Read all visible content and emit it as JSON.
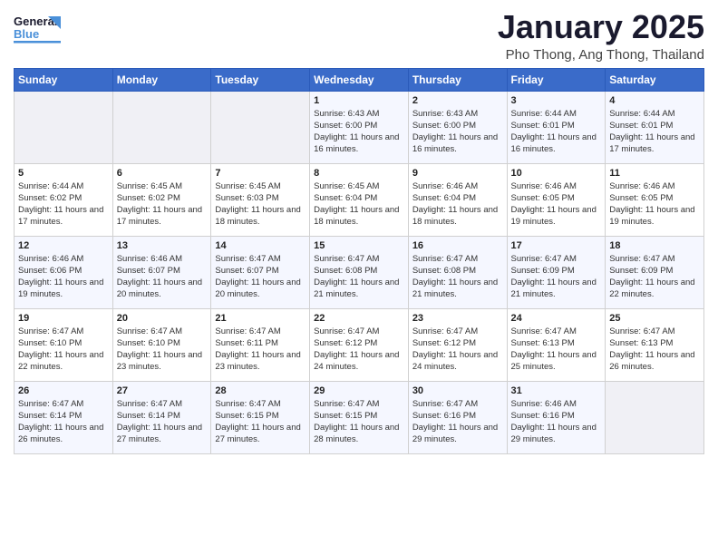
{
  "header": {
    "logo_line1": "General",
    "logo_line2": "Blue",
    "month_title": "January 2025",
    "subtitle": "Pho Thong, Ang Thong, Thailand"
  },
  "days_of_week": [
    "Sunday",
    "Monday",
    "Tuesday",
    "Wednesday",
    "Thursday",
    "Friday",
    "Saturday"
  ],
  "weeks": [
    [
      {
        "day": "",
        "info": ""
      },
      {
        "day": "",
        "info": ""
      },
      {
        "day": "",
        "info": ""
      },
      {
        "day": "1",
        "info": "Sunrise: 6:43 AM\nSunset: 6:00 PM\nDaylight: 11 hours and 16 minutes."
      },
      {
        "day": "2",
        "info": "Sunrise: 6:43 AM\nSunset: 6:00 PM\nDaylight: 11 hours and 16 minutes."
      },
      {
        "day": "3",
        "info": "Sunrise: 6:44 AM\nSunset: 6:01 PM\nDaylight: 11 hours and 16 minutes."
      },
      {
        "day": "4",
        "info": "Sunrise: 6:44 AM\nSunset: 6:01 PM\nDaylight: 11 hours and 17 minutes."
      }
    ],
    [
      {
        "day": "5",
        "info": "Sunrise: 6:44 AM\nSunset: 6:02 PM\nDaylight: 11 hours and 17 minutes."
      },
      {
        "day": "6",
        "info": "Sunrise: 6:45 AM\nSunset: 6:02 PM\nDaylight: 11 hours and 17 minutes."
      },
      {
        "day": "7",
        "info": "Sunrise: 6:45 AM\nSunset: 6:03 PM\nDaylight: 11 hours and 18 minutes."
      },
      {
        "day": "8",
        "info": "Sunrise: 6:45 AM\nSunset: 6:04 PM\nDaylight: 11 hours and 18 minutes."
      },
      {
        "day": "9",
        "info": "Sunrise: 6:46 AM\nSunset: 6:04 PM\nDaylight: 11 hours and 18 minutes."
      },
      {
        "day": "10",
        "info": "Sunrise: 6:46 AM\nSunset: 6:05 PM\nDaylight: 11 hours and 19 minutes."
      },
      {
        "day": "11",
        "info": "Sunrise: 6:46 AM\nSunset: 6:05 PM\nDaylight: 11 hours and 19 minutes."
      }
    ],
    [
      {
        "day": "12",
        "info": "Sunrise: 6:46 AM\nSunset: 6:06 PM\nDaylight: 11 hours and 19 minutes."
      },
      {
        "day": "13",
        "info": "Sunrise: 6:46 AM\nSunset: 6:07 PM\nDaylight: 11 hours and 20 minutes."
      },
      {
        "day": "14",
        "info": "Sunrise: 6:47 AM\nSunset: 6:07 PM\nDaylight: 11 hours and 20 minutes."
      },
      {
        "day": "15",
        "info": "Sunrise: 6:47 AM\nSunset: 6:08 PM\nDaylight: 11 hours and 21 minutes."
      },
      {
        "day": "16",
        "info": "Sunrise: 6:47 AM\nSunset: 6:08 PM\nDaylight: 11 hours and 21 minutes."
      },
      {
        "day": "17",
        "info": "Sunrise: 6:47 AM\nSunset: 6:09 PM\nDaylight: 11 hours and 21 minutes."
      },
      {
        "day": "18",
        "info": "Sunrise: 6:47 AM\nSunset: 6:09 PM\nDaylight: 11 hours and 22 minutes."
      }
    ],
    [
      {
        "day": "19",
        "info": "Sunrise: 6:47 AM\nSunset: 6:10 PM\nDaylight: 11 hours and 22 minutes."
      },
      {
        "day": "20",
        "info": "Sunrise: 6:47 AM\nSunset: 6:10 PM\nDaylight: 11 hours and 23 minutes."
      },
      {
        "day": "21",
        "info": "Sunrise: 6:47 AM\nSunset: 6:11 PM\nDaylight: 11 hours and 23 minutes."
      },
      {
        "day": "22",
        "info": "Sunrise: 6:47 AM\nSunset: 6:12 PM\nDaylight: 11 hours and 24 minutes."
      },
      {
        "day": "23",
        "info": "Sunrise: 6:47 AM\nSunset: 6:12 PM\nDaylight: 11 hours and 24 minutes."
      },
      {
        "day": "24",
        "info": "Sunrise: 6:47 AM\nSunset: 6:13 PM\nDaylight: 11 hours and 25 minutes."
      },
      {
        "day": "25",
        "info": "Sunrise: 6:47 AM\nSunset: 6:13 PM\nDaylight: 11 hours and 26 minutes."
      }
    ],
    [
      {
        "day": "26",
        "info": "Sunrise: 6:47 AM\nSunset: 6:14 PM\nDaylight: 11 hours and 26 minutes."
      },
      {
        "day": "27",
        "info": "Sunrise: 6:47 AM\nSunset: 6:14 PM\nDaylight: 11 hours and 27 minutes."
      },
      {
        "day": "28",
        "info": "Sunrise: 6:47 AM\nSunset: 6:15 PM\nDaylight: 11 hours and 27 minutes."
      },
      {
        "day": "29",
        "info": "Sunrise: 6:47 AM\nSunset: 6:15 PM\nDaylight: 11 hours and 28 minutes."
      },
      {
        "day": "30",
        "info": "Sunrise: 6:47 AM\nSunset: 6:16 PM\nDaylight: 11 hours and 29 minutes."
      },
      {
        "day": "31",
        "info": "Sunrise: 6:46 AM\nSunset: 6:16 PM\nDaylight: 11 hours and 29 minutes."
      },
      {
        "day": "",
        "info": ""
      }
    ]
  ]
}
